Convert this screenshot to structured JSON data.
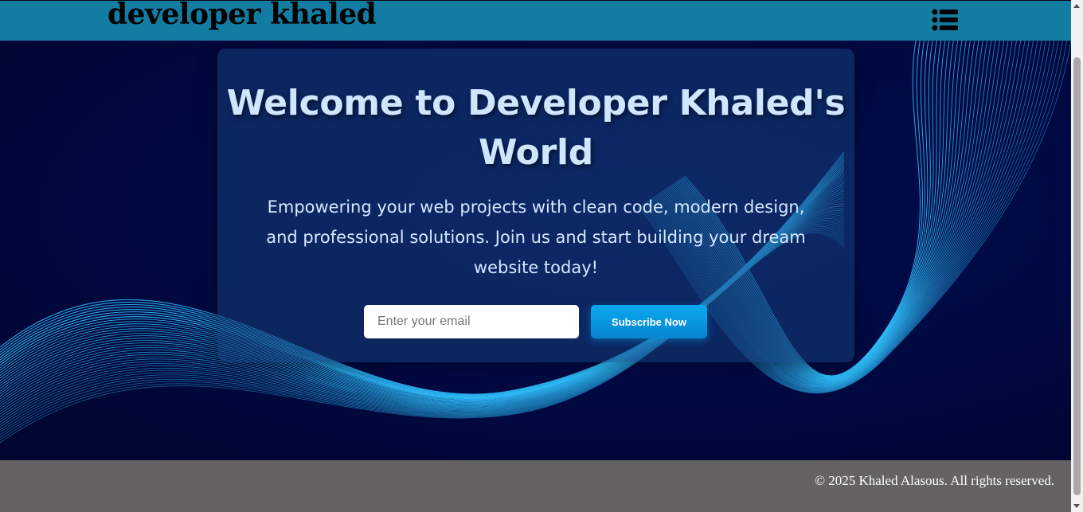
{
  "navbar": {
    "brand": "developer khaled",
    "menu_icon": "list-icon",
    "background": "#127ca3"
  },
  "hero": {
    "title": "Welcome to Developer Khaled's World",
    "description": "Empowering your web projects with clean code, modern design, and professional solutions. Join us and start building your dream website today!",
    "email_placeholder": "Enter your email",
    "email_value": "",
    "subscribe_label": "Subscribe Now",
    "accent": "#0aa7ef",
    "wave_color": "#2fc2ff"
  },
  "footer": {
    "copyright": "© 2025 Khaled Alasous. All rights reserved.",
    "background": "#646262"
  }
}
